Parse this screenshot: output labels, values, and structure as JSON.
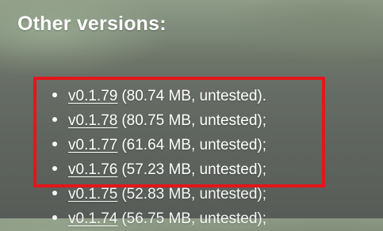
{
  "heading": "Other versions:",
  "versions": [
    {
      "label": "v0.1.79",
      "info": "(80.74 MB, untested)."
    },
    {
      "label": "v0.1.78",
      "info": "(80.75 MB, untested);"
    },
    {
      "label": "v0.1.77",
      "info": "(61.64 MB, untested);"
    },
    {
      "label": "v0.1.76",
      "info": "(57.23 MB, untested);"
    },
    {
      "label": "v0.1.75",
      "info": "(52.83 MB, untested);"
    },
    {
      "label": "v0.1.74",
      "info": "(56.75 MB, untested);"
    }
  ],
  "colors": {
    "highlight_border": "#e3161b",
    "text": "#ffffff"
  }
}
